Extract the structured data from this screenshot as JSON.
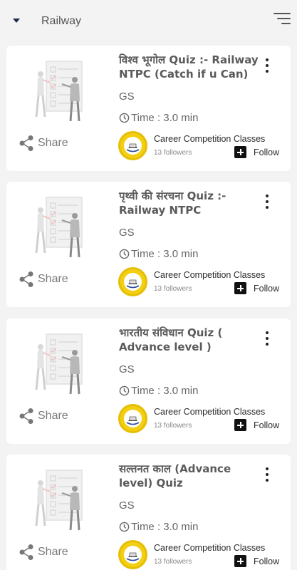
{
  "header": {
    "category": "Railway",
    "caret_icon": "caret-down-icon",
    "filter_icon": "filter-lines-icon"
  },
  "quizzes": [
    {
      "title": "विश्व भूगोल Quiz :- Railway NTPC (Catch if u Can)",
      "subject": "GS",
      "time": "Time : 3.0 min",
      "share_label": "Share",
      "publisher": "Career Competition Classes",
      "followers": "13 followers",
      "follow_label": "Follow"
    },
    {
      "title": "पृथ्वी की संरचना  Quiz  :- Railway NTPC",
      "subject": "GS",
      "time": "Time : 3.0 min",
      "share_label": "Share",
      "publisher": "Career Competition Classes",
      "followers": "13 followers",
      "follow_label": "Follow"
    },
    {
      "title": "भारतीय  संविधान Quiz ( Advance level )",
      "subject": "GS",
      "time": "Time : 3.0 min",
      "share_label": "Share",
      "publisher": "Career Competition Classes",
      "followers": "13 followers",
      "follow_label": "Follow"
    },
    {
      "title": "सल्तनत काल (Advance level) Quiz",
      "subject": "GS",
      "time": "Time : 3.0 min",
      "share_label": "Share",
      "publisher": "Career Competition Classes",
      "followers": "13 followers",
      "follow_label": "Follow"
    }
  ],
  "colors": {
    "background": "#f3f3f3",
    "card": "#ffffff",
    "logo_yellow": "#f2cf12",
    "follow_box": "#111111"
  }
}
